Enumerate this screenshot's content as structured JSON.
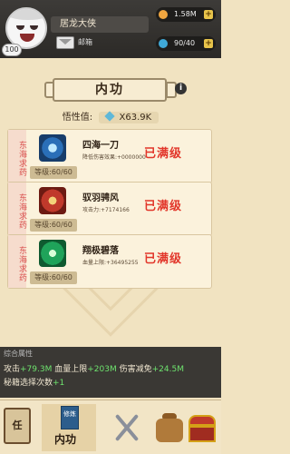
{
  "header": {
    "player_name": "居龙大侠",
    "level": "100",
    "mail_label": "邮箱",
    "gold": "1.58M",
    "energy": "90/40"
  },
  "title": "内功",
  "insight": {
    "label": "悟性值:",
    "value": "X63.9K"
  },
  "skills": [
    {
      "tag": "东海求药",
      "name": "四海一刀",
      "desc": "降低伤害效果:+0000000",
      "level": "等级:60/60",
      "status": "已满级",
      "icon": "blue-vortex-icon"
    },
    {
      "tag": "东海求药",
      "name": "驭羽骋风",
      "desc": "攻击力:+7174166",
      "level": "等级:60/60",
      "status": "已满级",
      "icon": "red-gate-icon"
    },
    {
      "tag": "东海求药",
      "name": "翔极碧落",
      "desc": "血量上限:+36495255",
      "level": "等级:60/60",
      "status": "已满级",
      "icon": "green-swirl-icon"
    }
  ],
  "summary": {
    "title": "综合属性",
    "attack_label": "攻击",
    "attack_value": "+79.3M",
    "hp_label": "血量上限",
    "hp_value": "+203M",
    "reduce_label": "伤害减免",
    "reduce_value": "+24.5M",
    "secret_label": "秘籍选择次数",
    "secret_value": "+1"
  },
  "nav": {
    "task_label": "任",
    "book_label": "修炼",
    "active_label": "内功"
  },
  "colors": {
    "maxed_red": "#e2362a",
    "bonus_green": "#6ee36e",
    "panel_bg": "#f1e3c1"
  }
}
